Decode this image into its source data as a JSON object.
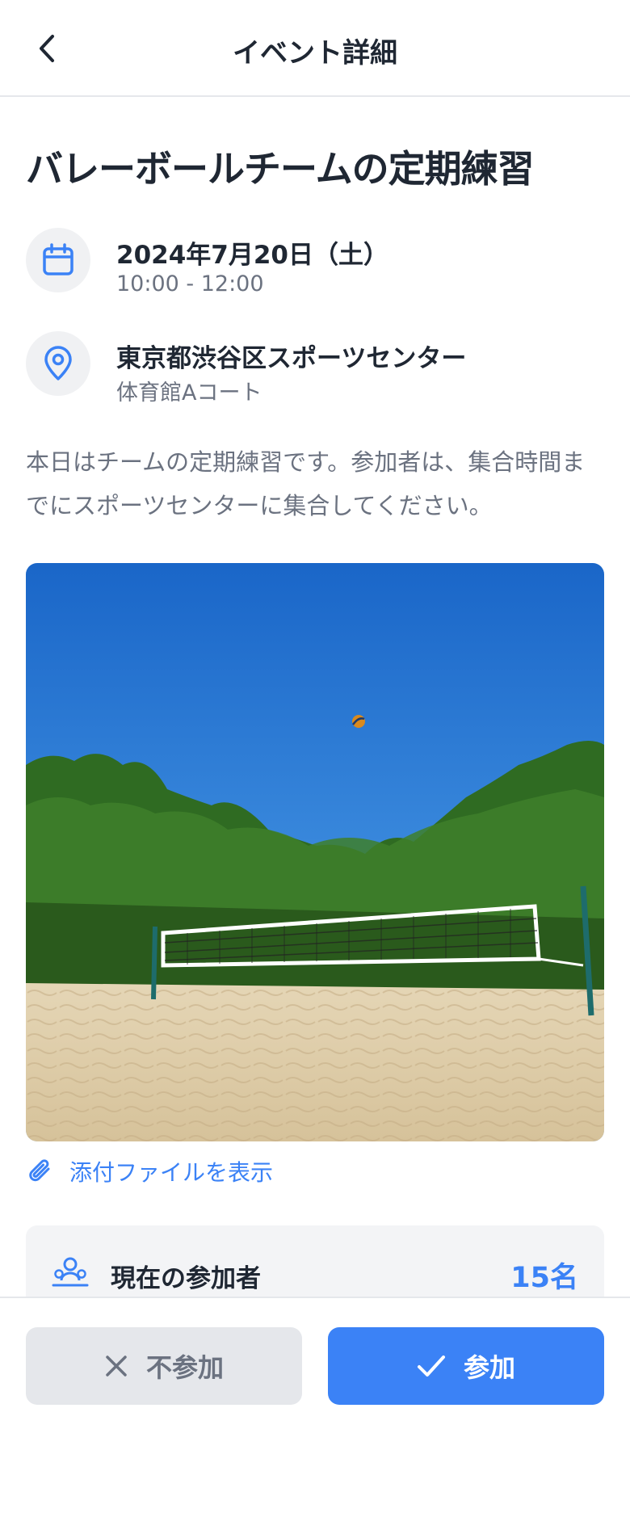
{
  "header": {
    "title": "イベント詳細",
    "back_icon": "chevron-left-icon"
  },
  "event": {
    "title": "バレーボールチームの定期練習",
    "date": "2024年7月20日（土）",
    "time": "10:00 - 12:00",
    "location_name": "東京都渋谷区スポーツセンター",
    "location_detail": "体育館Aコート",
    "description": "本日はチームの定期練習です。参加者は、集合時間までにスポーツセンターに集合してください。",
    "image": "beach-volleyball-court-photo"
  },
  "attachment": {
    "label": "添付ファイルを表示",
    "icon": "paperclip-icon"
  },
  "participants": {
    "label": "現在の参加者",
    "count": "15名",
    "icon": "group-icon"
  },
  "actions": {
    "decline_label": "不参加",
    "join_label": "参加"
  },
  "colors": {
    "accent": "#3b82f6",
    "text_primary": "#1f2733",
    "text_secondary": "#6b7280",
    "surface": "#f3f4f6"
  }
}
